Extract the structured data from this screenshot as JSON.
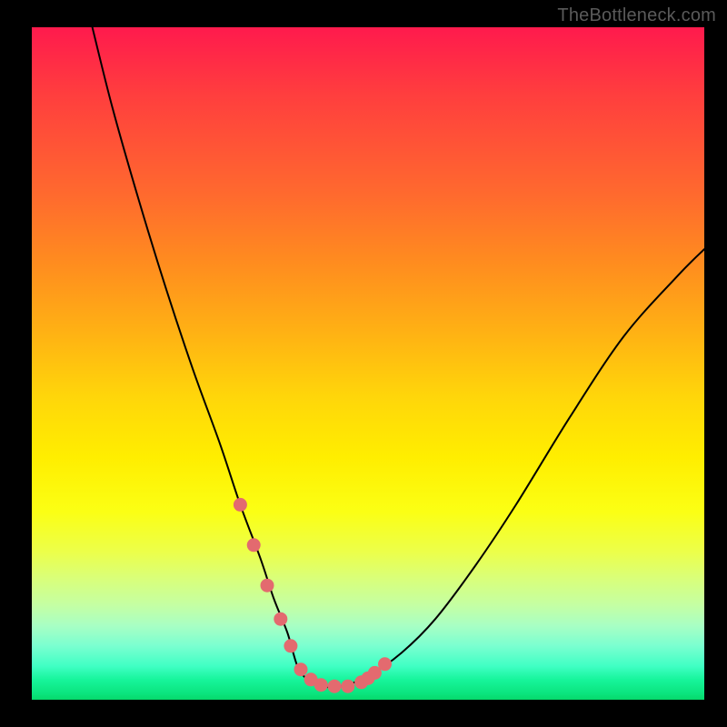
{
  "watermark": "TheBottleneck.com",
  "chart_data": {
    "type": "line",
    "title": "",
    "xlabel": "",
    "ylabel": "",
    "xlim": [
      0,
      100
    ],
    "ylim": [
      0,
      100
    ],
    "background_gradient": {
      "top": "#ff1a4d",
      "middle": "#ffee00",
      "bottom": "#06d96b"
    },
    "series": [
      {
        "name": "bottleneck-curve",
        "color": "#000000",
        "x": [
          9,
          12,
          16,
          20,
          24,
          28,
          31,
          34,
          36,
          38,
          39.5,
          41,
          43,
          46,
          50,
          55,
          60,
          66,
          72,
          80,
          88,
          96,
          100
        ],
        "y": [
          100,
          88,
          74,
          61,
          49,
          38,
          29,
          21,
          15,
          10,
          5,
          3,
          2,
          2,
          3.5,
          7,
          12,
          20,
          29,
          42,
          54,
          63,
          67
        ]
      }
    ],
    "markers": {
      "name": "highlight-points",
      "color": "#e36a6f",
      "x": [
        31,
        33,
        35,
        37,
        38.5,
        40,
        41.5,
        43,
        45,
        47,
        49,
        50,
        51,
        52.5
      ],
      "y": [
        29,
        23,
        17,
        12,
        8,
        4.5,
        3,
        2.2,
        2,
        2,
        2.6,
        3.2,
        4,
        5.3
      ]
    }
  }
}
